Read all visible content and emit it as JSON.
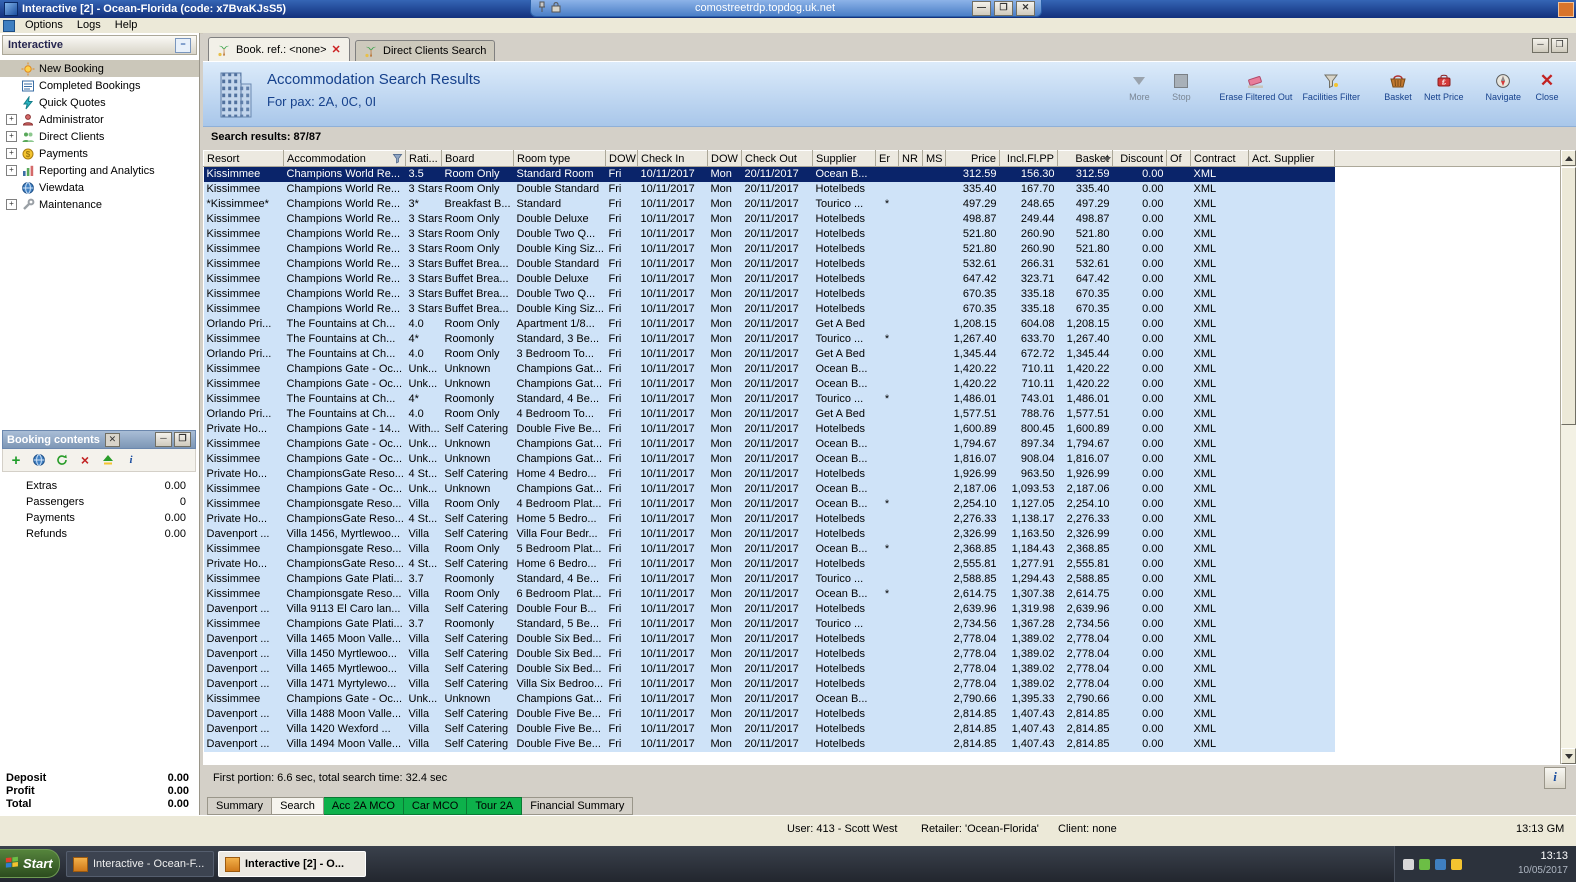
{
  "window": {
    "title": "Interactive [2] - Ocean-Florida (code: x7BvaKJsS5)",
    "rdp_host": "comostreetrdp.topdog.uk.net",
    "rdp_buttons": {
      "minimize": "—",
      "restore": "❐",
      "close": "✕"
    }
  },
  "menu": [
    "Options",
    "Logs",
    "Help"
  ],
  "sidebar": {
    "title": "Interactive",
    "items": [
      {
        "label": "New Booking"
      },
      {
        "label": "Completed Bookings"
      },
      {
        "label": "Quick Quotes"
      },
      {
        "label": "Administrator"
      },
      {
        "label": "Direct Clients"
      },
      {
        "label": "Payments"
      },
      {
        "label": "Reporting and Analytics"
      },
      {
        "label": "Viewdata"
      },
      {
        "label": "Maintenance"
      }
    ]
  },
  "booking": {
    "title": "Booking contents",
    "rows": [
      {
        "label": "Extras",
        "value": "0.00"
      },
      {
        "label": "Passengers",
        "value": "0"
      },
      {
        "label": "Payments",
        "value": "0.00"
      },
      {
        "label": "Refunds",
        "value": "0.00"
      }
    ],
    "totals": [
      {
        "label": "Deposit",
        "value": "0.00"
      },
      {
        "label": "Profit",
        "value": "0.00"
      },
      {
        "label": "Total",
        "value": "0.00"
      }
    ]
  },
  "tabs": [
    {
      "label": "Book. ref.: <none>"
    },
    {
      "label": "Direct Clients Search"
    }
  ],
  "header": {
    "title": "Accommodation Search Results",
    "subtitle": "For pax: 2A, 0C, 0I",
    "buttons": [
      "More",
      "Stop",
      "Erase Filtered Out",
      "Facilities Filter",
      "Basket",
      "Nett Price",
      "Navigate",
      "Close"
    ]
  },
  "results_label": "Search results: 87/87",
  "table": {
    "columns": [
      "Resort",
      "Accommodation",
      "Rati...",
      "Board",
      "Room type",
      "DOW",
      "Check In",
      "DOW",
      "Check Out",
      "Supplier",
      "Er",
      "NR",
      "MS",
      "Price",
      "Incl.Fl.PP",
      "Basket",
      "Discount",
      "Of",
      "Contract",
      "Act. Supplier"
    ],
    "selected_row": 0,
    "rows": [
      [
        "Kissimmee",
        "Champions World Re...",
        "3.5",
        "Room Only",
        "Standard Room",
        "Fri",
        "10/11/2017",
        "Mon",
        "20/11/2017",
        "Ocean B...",
        "",
        "",
        "",
        "312.59",
        "156.30",
        "312.59",
        "0.00",
        "",
        "XML",
        ""
      ],
      [
        "Kissimmee",
        "Champions World Re...",
        "3 Stars",
        "Room Only",
        "Double Standard",
        "Fri",
        "10/11/2017",
        "Mon",
        "20/11/2017",
        "Hotelbeds",
        "",
        "",
        "",
        "335.40",
        "167.70",
        "335.40",
        "0.00",
        "",
        "XML",
        ""
      ],
      [
        "*Kissimmee*",
        "Champions World Re...",
        "3*",
        "Breakfast B...",
        "Standard",
        "Fri",
        "10/11/2017",
        "Mon",
        "20/11/2017",
        "Tourico ...",
        "*",
        "",
        "",
        "497.29",
        "248.65",
        "497.29",
        "0.00",
        "",
        "XML",
        ""
      ],
      [
        "Kissimmee",
        "Champions World Re...",
        "3 Stars",
        "Room Only",
        "Double Deluxe",
        "Fri",
        "10/11/2017",
        "Mon",
        "20/11/2017",
        "Hotelbeds",
        "",
        "",
        "",
        "498.87",
        "249.44",
        "498.87",
        "0.00",
        "",
        "XML",
        ""
      ],
      [
        "Kissimmee",
        "Champions World Re...",
        "3 Stars",
        "Room Only",
        "Double Two Q...",
        "Fri",
        "10/11/2017",
        "Mon",
        "20/11/2017",
        "Hotelbeds",
        "",
        "",
        "",
        "521.80",
        "260.90",
        "521.80",
        "0.00",
        "",
        "XML",
        ""
      ],
      [
        "Kissimmee",
        "Champions World Re...",
        "3 Stars",
        "Room Only",
        "Double King Siz...",
        "Fri",
        "10/11/2017",
        "Mon",
        "20/11/2017",
        "Hotelbeds",
        "",
        "",
        "",
        "521.80",
        "260.90",
        "521.80",
        "0.00",
        "",
        "XML",
        ""
      ],
      [
        "Kissimmee",
        "Champions World Re...",
        "3 Stars",
        "Buffet Brea...",
        "Double Standard",
        "Fri",
        "10/11/2017",
        "Mon",
        "20/11/2017",
        "Hotelbeds",
        "",
        "",
        "",
        "532.61",
        "266.31",
        "532.61",
        "0.00",
        "",
        "XML",
        ""
      ],
      [
        "Kissimmee",
        "Champions World Re...",
        "3 Stars",
        "Buffet Brea...",
        "Double Deluxe",
        "Fri",
        "10/11/2017",
        "Mon",
        "20/11/2017",
        "Hotelbeds",
        "",
        "",
        "",
        "647.42",
        "323.71",
        "647.42",
        "0.00",
        "",
        "XML",
        ""
      ],
      [
        "Kissimmee",
        "Champions World Re...",
        "3 Stars",
        "Buffet Brea...",
        "Double Two Q...",
        "Fri",
        "10/11/2017",
        "Mon",
        "20/11/2017",
        "Hotelbeds",
        "",
        "",
        "",
        "670.35",
        "335.18",
        "670.35",
        "0.00",
        "",
        "XML",
        ""
      ],
      [
        "Kissimmee",
        "Champions World Re...",
        "3 Stars",
        "Buffet Brea...",
        "Double King Siz...",
        "Fri",
        "10/11/2017",
        "Mon",
        "20/11/2017",
        "Hotelbeds",
        "",
        "",
        "",
        "670.35",
        "335.18",
        "670.35",
        "0.00",
        "",
        "XML",
        ""
      ],
      [
        "Orlando Pri...",
        "The Fountains at Ch...",
        "4.0",
        "Room Only",
        "Apartment 1/8...",
        "Fri",
        "10/11/2017",
        "Mon",
        "20/11/2017",
        "Get A Bed",
        "",
        "",
        "",
        "1,208.15",
        "604.08",
        "1,208.15",
        "0.00",
        "",
        "XML",
        ""
      ],
      [
        "Kissimmee",
        "The Fountains at Ch...",
        "4*",
        "Roomonly",
        "Standard, 3 Be...",
        "Fri",
        "10/11/2017",
        "Mon",
        "20/11/2017",
        "Tourico ...",
        "*",
        "",
        "",
        "1,267.40",
        "633.70",
        "1,267.40",
        "0.00",
        "",
        "XML",
        ""
      ],
      [
        "Orlando Pri...",
        "The Fountains at Ch...",
        "4.0",
        "Room Only",
        "3 Bedroom To...",
        "Fri",
        "10/11/2017",
        "Mon",
        "20/11/2017",
        "Get A Bed",
        "",
        "",
        "",
        "1,345.44",
        "672.72",
        "1,345.44",
        "0.00",
        "",
        "XML",
        ""
      ],
      [
        "Kissimmee",
        "Champions Gate - Oc...",
        "Unk...",
        "Unknown",
        "Champions Gat...",
        "Fri",
        "10/11/2017",
        "Mon",
        "20/11/2017",
        "Ocean B...",
        "",
        "",
        "",
        "1,420.22",
        "710.11",
        "1,420.22",
        "0.00",
        "",
        "XML",
        ""
      ],
      [
        "Kissimmee",
        "Champions Gate - Oc...",
        "Unk...",
        "Unknown",
        "Champions Gat...",
        "Fri",
        "10/11/2017",
        "Mon",
        "20/11/2017",
        "Ocean B...",
        "",
        "",
        "",
        "1,420.22",
        "710.11",
        "1,420.22",
        "0.00",
        "",
        "XML",
        ""
      ],
      [
        "Kissimmee",
        "The Fountains at Ch...",
        "4*",
        "Roomonly",
        "Standard, 4 Be...",
        "Fri",
        "10/11/2017",
        "Mon",
        "20/11/2017",
        "Tourico ...",
        "*",
        "",
        "",
        "1,486.01",
        "743.01",
        "1,486.01",
        "0.00",
        "",
        "XML",
        ""
      ],
      [
        "Orlando Pri...",
        "The Fountains at Ch...",
        "4.0",
        "Room Only",
        "4 Bedroom To...",
        "Fri",
        "10/11/2017",
        "Mon",
        "20/11/2017",
        "Get A Bed",
        "",
        "",
        "",
        "1,577.51",
        "788.76",
        "1,577.51",
        "0.00",
        "",
        "XML",
        ""
      ],
      [
        "Private Ho...",
        "Champions Gate - 14...",
        "With...",
        "Self Catering",
        "Double Five Be...",
        "Fri",
        "10/11/2017",
        "Mon",
        "20/11/2017",
        "Hotelbeds",
        "",
        "",
        "",
        "1,600.89",
        "800.45",
        "1,600.89",
        "0.00",
        "",
        "XML",
        ""
      ],
      [
        "Kissimmee",
        "Champions Gate - Oc...",
        "Unk...",
        "Unknown",
        "Champions Gat...",
        "Fri",
        "10/11/2017",
        "Mon",
        "20/11/2017",
        "Ocean B...",
        "",
        "",
        "",
        "1,794.67",
        "897.34",
        "1,794.67",
        "0.00",
        "",
        "XML",
        ""
      ],
      [
        "Kissimmee",
        "Champions Gate - Oc...",
        "Unk...",
        "Unknown",
        "Champions Gat...",
        "Fri",
        "10/11/2017",
        "Mon",
        "20/11/2017",
        "Ocean B...",
        "",
        "",
        "",
        "1,816.07",
        "908.04",
        "1,816.07",
        "0.00",
        "",
        "XML",
        ""
      ],
      [
        "Private Ho...",
        "ChampionsGate Reso...",
        "4 St...",
        "Self Catering",
        "Home 4 Bedro...",
        "Fri",
        "10/11/2017",
        "Mon",
        "20/11/2017",
        "Hotelbeds",
        "",
        "",
        "",
        "1,926.99",
        "963.50",
        "1,926.99",
        "0.00",
        "",
        "XML",
        ""
      ],
      [
        "Kissimmee",
        "Champions Gate - Oc...",
        "Unk...",
        "Unknown",
        "Champions Gat...",
        "Fri",
        "10/11/2017",
        "Mon",
        "20/11/2017",
        "Ocean B...",
        "",
        "",
        "",
        "2,187.06",
        "1,093.53",
        "2,187.06",
        "0.00",
        "",
        "XML",
        ""
      ],
      [
        "Kissimmee",
        "Championsgate Reso...",
        "Villa",
        "Room Only",
        "4 Bedroom Plat...",
        "Fri",
        "10/11/2017",
        "Mon",
        "20/11/2017",
        "Ocean B...",
        "*",
        "",
        "",
        "2,254.10",
        "1,127.05",
        "2,254.10",
        "0.00",
        "",
        "XML",
        ""
      ],
      [
        "Private Ho...",
        "ChampionsGate Reso...",
        "4 St...",
        "Self Catering",
        "Home 5 Bedro...",
        "Fri",
        "10/11/2017",
        "Mon",
        "20/11/2017",
        "Hotelbeds",
        "",
        "",
        "",
        "2,276.33",
        "1,138.17",
        "2,276.33",
        "0.00",
        "",
        "XML",
        ""
      ],
      [
        "Davenport ...",
        "Villa 1456, Myrtlewoo...",
        "Villa",
        "Self Catering",
        "Villa Four Bedr...",
        "Fri",
        "10/11/2017",
        "Mon",
        "20/11/2017",
        "Hotelbeds",
        "",
        "",
        "",
        "2,326.99",
        "1,163.50",
        "2,326.99",
        "0.00",
        "",
        "XML",
        ""
      ],
      [
        "Kissimmee",
        "Championsgate Reso...",
        "Villa",
        "Room Only",
        "5 Bedroom Plat...",
        "Fri",
        "10/11/2017",
        "Mon",
        "20/11/2017",
        "Ocean B...",
        "*",
        "",
        "",
        "2,368.85",
        "1,184.43",
        "2,368.85",
        "0.00",
        "",
        "XML",
        ""
      ],
      [
        "Private Ho...",
        "ChampionsGate Reso...",
        "4 St...",
        "Self Catering",
        "Home 6 Bedro...",
        "Fri",
        "10/11/2017",
        "Mon",
        "20/11/2017",
        "Hotelbeds",
        "",
        "",
        "",
        "2,555.81",
        "1,277.91",
        "2,555.81",
        "0.00",
        "",
        "XML",
        ""
      ],
      [
        "Kissimmee",
        "Champions Gate Plati...",
        "3.7",
        "Roomonly",
        "Standard, 4 Be...",
        "Fri",
        "10/11/2017",
        "Mon",
        "20/11/2017",
        "Tourico ...",
        "",
        "",
        "",
        "2,588.85",
        "1,294.43",
        "2,588.85",
        "0.00",
        "",
        "XML",
        ""
      ],
      [
        "Kissimmee",
        "Championsgate Reso...",
        "Villa",
        "Room Only",
        "6 Bedroom Plat...",
        "Fri",
        "10/11/2017",
        "Mon",
        "20/11/2017",
        "Ocean B...",
        "*",
        "",
        "",
        "2,614.75",
        "1,307.38",
        "2,614.75",
        "0.00",
        "",
        "XML",
        ""
      ],
      [
        "Davenport ...",
        "Villa 9113 El Caro lan...",
        "Villa",
        "Self Catering",
        "Double Four B...",
        "Fri",
        "10/11/2017",
        "Mon",
        "20/11/2017",
        "Hotelbeds",
        "",
        "",
        "",
        "2,639.96",
        "1,319.98",
        "2,639.96",
        "0.00",
        "",
        "XML",
        ""
      ],
      [
        "Kissimmee",
        "Champions Gate Plati...",
        "3.7",
        "Roomonly",
        "Standard, 5 Be...",
        "Fri",
        "10/11/2017",
        "Mon",
        "20/11/2017",
        "Tourico ...",
        "",
        "",
        "",
        "2,734.56",
        "1,367.28",
        "2,734.56",
        "0.00",
        "",
        "XML",
        ""
      ],
      [
        "Davenport ...",
        "Villa 1465 Moon Valle...",
        "Villa",
        "Self Catering",
        "Double Six Bed...",
        "Fri",
        "10/11/2017",
        "Mon",
        "20/11/2017",
        "Hotelbeds",
        "",
        "",
        "",
        "2,778.04",
        "1,389.02",
        "2,778.04",
        "0.00",
        "",
        "XML",
        ""
      ],
      [
        "Davenport ...",
        "Villa 1450 Myrtlewoo...",
        "Villa",
        "Self Catering",
        "Double Six Bed...",
        "Fri",
        "10/11/2017",
        "Mon",
        "20/11/2017",
        "Hotelbeds",
        "",
        "",
        "",
        "2,778.04",
        "1,389.02",
        "2,778.04",
        "0.00",
        "",
        "XML",
        ""
      ],
      [
        "Davenport ...",
        "Villa 1465 Myrtlewoo...",
        "Villa",
        "Self Catering",
        "Double Six Bed...",
        "Fri",
        "10/11/2017",
        "Mon",
        "20/11/2017",
        "Hotelbeds",
        "",
        "",
        "",
        "2,778.04",
        "1,389.02",
        "2,778.04",
        "0.00",
        "",
        "XML",
        ""
      ],
      [
        "Davenport ...",
        "Villa 1471 Myrtylewo...",
        "Villa",
        "Self Catering",
        "Villa Six Bedroo...",
        "Fri",
        "10/11/2017",
        "Mon",
        "20/11/2017",
        "Hotelbeds",
        "",
        "",
        "",
        "2,778.04",
        "1,389.02",
        "2,778.04",
        "0.00",
        "",
        "XML",
        ""
      ],
      [
        "Kissimmee",
        "Champions Gate - Oc...",
        "Unk...",
        "Unknown",
        "Champions Gat...",
        "Fri",
        "10/11/2017",
        "Mon",
        "20/11/2017",
        "Ocean B...",
        "",
        "",
        "",
        "2,790.66",
        "1,395.33",
        "2,790.66",
        "0.00",
        "",
        "XML",
        ""
      ],
      [
        "Davenport ...",
        "Villa 1488 Moon Valle...",
        "Villa",
        "Self Catering",
        "Double Five Be...",
        "Fri",
        "10/11/2017",
        "Mon",
        "20/11/2017",
        "Hotelbeds",
        "",
        "",
        "",
        "2,814.85",
        "1,407.43",
        "2,814.85",
        "0.00",
        "",
        "XML",
        ""
      ],
      [
        "Davenport ...",
        "Villa 1420 Wexford ...",
        "Villa",
        "Self Catering",
        "Double Five Be...",
        "Fri",
        "10/11/2017",
        "Mon",
        "20/11/2017",
        "Hotelbeds",
        "",
        "",
        "",
        "2,814.85",
        "1,407.43",
        "2,814.85",
        "0.00",
        "",
        "XML",
        ""
      ],
      [
        "Davenport ...",
        "Villa 1494 Moon Valle...",
        "Villa",
        "Self Catering",
        "Double Five Be...",
        "Fri",
        "10/11/2017",
        "Mon",
        "20/11/2017",
        "Hotelbeds",
        "",
        "",
        "",
        "2,814.85",
        "1,407.43",
        "2,814.85",
        "0.00",
        "",
        "XML",
        ""
      ]
    ]
  },
  "footer": {
    "text": "First portion: 6.6 sec, total search time: 32.4 sec"
  },
  "bottom_tabs": [
    "Summary",
    "Search",
    "Acc 2A MCO",
    "Car MCO",
    "Tour 2A",
    "Financial Summary"
  ],
  "status": {
    "user": "User: 413 - Scott West",
    "retailer": "Retailer: 'Ocean-Florida'",
    "client": "Client: none",
    "time": "13:13 GM"
  },
  "taskbar": {
    "start_label": "Start",
    "tasks": [
      "Interactive - Ocean-F...",
      "Interactive [2] - O..."
    ],
    "clock": "13:13",
    "date": "10/05/2017"
  }
}
